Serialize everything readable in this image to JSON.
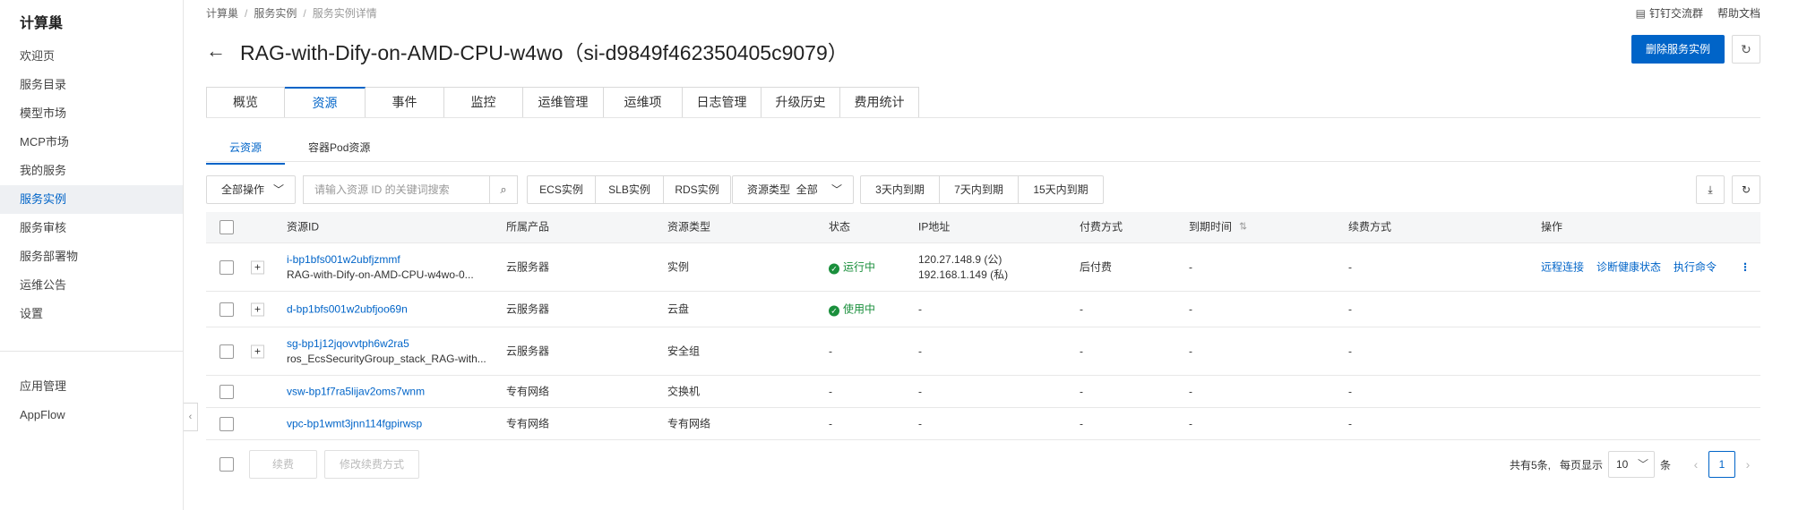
{
  "sidebar": {
    "brand": "计算巢",
    "items": [
      {
        "label": "欢迎页",
        "active": false
      },
      {
        "label": "服务目录",
        "active": false
      },
      {
        "label": "模型市场",
        "active": false
      },
      {
        "label": "MCP市场",
        "active": false
      },
      {
        "label": "我的服务",
        "active": false
      },
      {
        "label": "服务实例",
        "active": true
      },
      {
        "label": "服务审核",
        "active": false
      },
      {
        "label": "服务部署物",
        "active": false
      },
      {
        "label": "运维公告",
        "active": false
      },
      {
        "label": "设置",
        "active": false
      }
    ],
    "bottom_items": [
      {
        "label": "应用管理"
      },
      {
        "label": "AppFlow"
      }
    ]
  },
  "breadcrumb": [
    "计算巢",
    "服务实例",
    "服务实例详情"
  ],
  "top_links": {
    "dingtalk": "钉钉交流群",
    "help": "帮助文档"
  },
  "page_title": "RAG-with-Dify-on-AMD-CPU-w4wo（si-d9849f462350405c9079）",
  "delete_button": "删除服务实例",
  "tabs": [
    "概览",
    "资源",
    "事件",
    "监控",
    "运维管理",
    "运维项",
    "日志管理",
    "升级历史",
    "费用统计"
  ],
  "active_tab": "资源",
  "subtabs": [
    "云资源",
    "容器Pod资源"
  ],
  "toolbar": {
    "all_actions": "全部操作",
    "search_placeholder": "请输入资源 ID 的关键词搜索",
    "instance_filters": [
      "ECS实例",
      "SLB实例",
      "RDS实例"
    ],
    "resource_type_label": "资源类型",
    "resource_type_value": "全部",
    "expiry_filters": [
      "3天内到期",
      "7天内到期",
      "15天内到期"
    ]
  },
  "table": {
    "columns": [
      "资源ID",
      "所属产品",
      "资源类型",
      "状态",
      "IP地址",
      "付费方式",
      "到期时间",
      "续费方式",
      "操作"
    ],
    "rows": [
      {
        "id": "i-bp1bfs001w2ubfjzmmf",
        "sub": "RAG-with-Dify-on-AMD-CPU-w4wo-0...",
        "product": "云服务器",
        "type": "实例",
        "status": "运行中",
        "ip1": "120.27.148.9 (公)",
        "ip2": "192.168.1.149 (私)",
        "pay": "后付费",
        "expire": "-",
        "renew": "-",
        "actions": [
          "远程连接",
          "诊断健康状态",
          "执行命令"
        ],
        "expandable": true
      },
      {
        "id": "d-bp1bfs001w2ubfjoo69n",
        "sub": "",
        "product": "云服务器",
        "type": "云盘",
        "status": "使用中",
        "ip1": "-",
        "ip2": "",
        "pay": "-",
        "expire": "-",
        "renew": "-",
        "actions": [],
        "expandable": true
      },
      {
        "id": "sg-bp1j12jqovvtph6w2ra5",
        "sub": "ros_EcsSecurityGroup_stack_RAG-with...",
        "product": "云服务器",
        "type": "安全组",
        "status": "-",
        "ip1": "-",
        "ip2": "",
        "pay": "-",
        "expire": "-",
        "renew": "-",
        "actions": [],
        "expandable": true
      },
      {
        "id": "vsw-bp1f7ra5lijav2oms7wnm",
        "sub": "",
        "product": "专有网络",
        "type": "交换机",
        "status": "-",
        "ip1": "-",
        "ip2": "",
        "pay": "-",
        "expire": "-",
        "renew": "-",
        "actions": [],
        "expandable": false
      },
      {
        "id": "vpc-bp1wmt3jnn114fgpirwsp",
        "sub": "",
        "product": "专有网络",
        "type": "专有网络",
        "status": "-",
        "ip1": "-",
        "ip2": "",
        "pay": "-",
        "expire": "-",
        "renew": "-",
        "actions": [],
        "expandable": false
      }
    ]
  },
  "footer": {
    "renew_button": "续费",
    "modify_renew_button": "修改续费方式",
    "total": "共有5条,",
    "per_page": "每页显示",
    "page_size": "10",
    "unit": "条",
    "current_page": "1"
  }
}
